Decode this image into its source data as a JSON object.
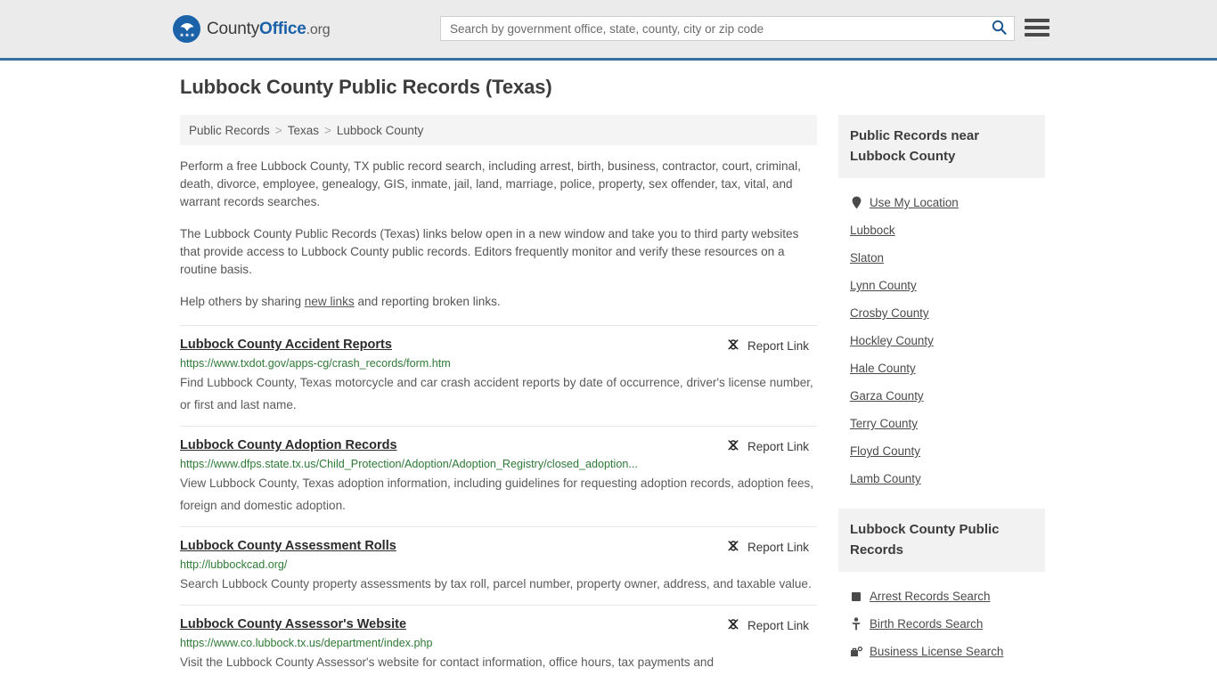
{
  "header": {
    "logo": {
      "part1": "County",
      "part2": "Office",
      "part3": ".org",
      "icon": "eagle-shield-logo"
    },
    "search": {
      "placeholder": "Search by government office, state, county, city or zip code",
      "value": "",
      "search_icon": "search-icon"
    },
    "menu_icon": "hamburger-menu-icon"
  },
  "page": {
    "title": "Lubbock County Public Records (Texas)"
  },
  "breadcrumb": {
    "items": [
      {
        "label": "Public Records",
        "current": false
      },
      {
        "label": "Texas",
        "current": false
      },
      {
        "label": "Lubbock County",
        "current": true
      }
    ],
    "separator": ">"
  },
  "intro": {
    "p1": "Perform a free Lubbock County, TX public record search, including arrest, birth, business, contractor, court, criminal, death, divorce, employee, genealogy, GIS, inmate, jail, land, marriage, police, property, sex offender, tax, vital, and warrant records searches.",
    "p2": "The Lubbock County Public Records (Texas) links below open in a new window and take you to third party websites that provide access to Lubbock County public records. Editors frequently monitor and verify these resources on a routine basis.",
    "p3_before": "Help others by sharing ",
    "p3_link": "new links",
    "p3_after": " and reporting broken links."
  },
  "records": {
    "report_label": "Report Link",
    "report_icon": "broken-link-icon",
    "items": [
      {
        "title": "Lubbock County Accident Reports",
        "url": "https://www.txdot.gov/apps-cg/crash_records/form.htm",
        "description": "Find Lubbock County, Texas motorcycle and car crash accident reports by date of occurrence, driver's license number, or first and last name."
      },
      {
        "title": "Lubbock County Adoption Records",
        "url": "https://www.dfps.state.tx.us/Child_Protection/Adoption/Adoption_Registry/closed_adoption...",
        "description": "View Lubbock County, Texas adoption information, including guidelines for requesting adoption records, adoption fees, foreign and domestic adoption."
      },
      {
        "title": "Lubbock County Assessment Rolls",
        "url": "http://lubbockcad.org/",
        "description": "Search Lubbock County property assessments by tax roll, parcel number, property owner, address, and taxable value."
      },
      {
        "title": "Lubbock County Assessor's Website",
        "url": "https://www.co.lubbock.tx.us/department/index.php",
        "description": "Visit the Lubbock County Assessor's website for contact information, office hours, tax payments and"
      }
    ]
  },
  "sidebar": {
    "nearby": {
      "heading": "Public Records near Lubbock County",
      "items": [
        {
          "label": "Use My Location",
          "icon": "location-pin-icon"
        },
        {
          "label": "Lubbock",
          "icon": ""
        },
        {
          "label": "Slaton",
          "icon": ""
        },
        {
          "label": "Lynn County",
          "icon": ""
        },
        {
          "label": "Crosby County",
          "icon": ""
        },
        {
          "label": "Hockley County",
          "icon": ""
        },
        {
          "label": "Hale County",
          "icon": ""
        },
        {
          "label": "Garza County",
          "icon": ""
        },
        {
          "label": "Terry County",
          "icon": ""
        },
        {
          "label": "Floyd County",
          "icon": ""
        },
        {
          "label": "Lamb County",
          "icon": ""
        }
      ]
    },
    "county_records": {
      "heading": "Lubbock County Public Records",
      "items": [
        {
          "label": "Arrest Records Search",
          "icon": "fingerprint-icon"
        },
        {
          "label": "Birth Records Search",
          "icon": "baby-icon"
        },
        {
          "label": "Business License Search",
          "icon": "briefcase-gear-icon"
        }
      ]
    }
  },
  "colors": {
    "brand_blue": "#1b62a8",
    "header_bg": "#ebebeb",
    "header_border": "#36719f",
    "url_green": "#2d7a35",
    "panel_bg": "#f2f2f2"
  }
}
